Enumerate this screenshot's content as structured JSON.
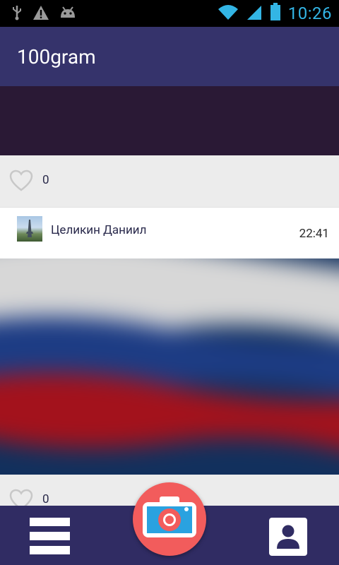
{
  "status_bar": {
    "time": "10:26",
    "icons": [
      "usb-icon",
      "warning-icon",
      "android-debug-icon",
      "wifi-icon",
      "signal-icon",
      "battery-icon"
    ],
    "accent": "#33b5e5"
  },
  "app_bar": {
    "title": "100gram",
    "background": "#35336b"
  },
  "feed": {
    "posts": [
      {
        "likes": "0",
        "photo_color": "#2a1935"
      },
      {
        "author": "Целикин Даниил",
        "time": "22:41",
        "photo_description_colors": [
          "#e6e6e6",
          "#1e3d85",
          "#a3121c"
        ],
        "likes": "0"
      }
    ]
  },
  "bottom_bar": {
    "background": "#302c63",
    "menu_icon": "list-icon",
    "camera_icon": "camera-icon",
    "camera_color": "#f25c5c",
    "profile_icon": "profile-icon"
  }
}
